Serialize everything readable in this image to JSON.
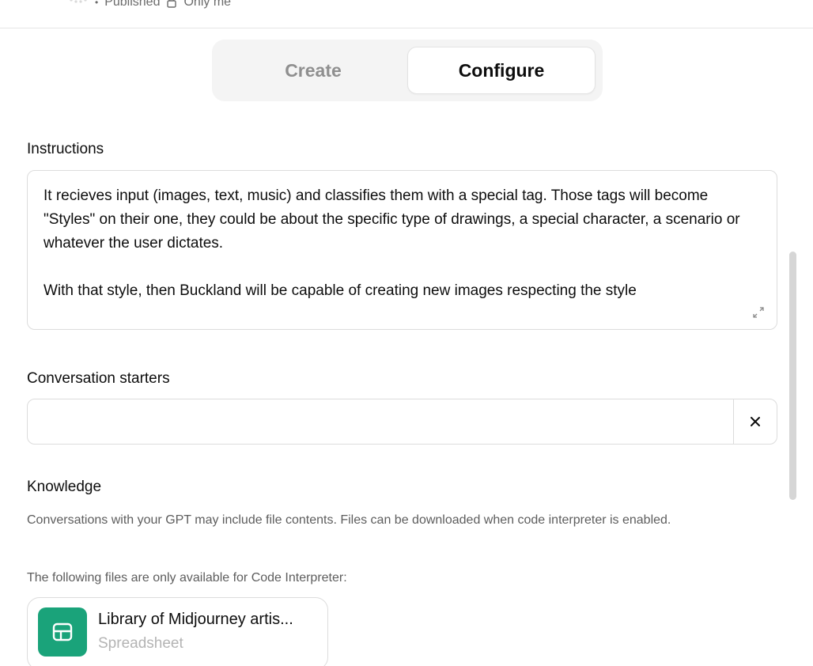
{
  "header": {
    "status_label": "Published",
    "visibility_label": "Only me"
  },
  "tabs": [
    {
      "label": "Create",
      "active": false
    },
    {
      "label": "Configure",
      "active": true
    }
  ],
  "instructions": {
    "label": "Instructions",
    "value": "It recieves input (images, text, music) and classifies them with a special tag. Those tags will become \"Styles\" on their one, they could be about the specific type of drawings, a special character, a scenario or whatever the user dictates.\n\nWith that style, then Buckland will be capable of creating new images respecting the style"
  },
  "conversation_starters": {
    "label": "Conversation starters",
    "value": "",
    "placeholder": ""
  },
  "knowledge": {
    "label": "Knowledge",
    "description": "Conversations with your GPT may include file contents. Files can be downloaded when code interpreter is enabled.",
    "code_interpreter_note": "The following files are only available for Code Interpreter:",
    "files": [
      {
        "name": "Library of Midjourney artis...",
        "type": "Spreadsheet",
        "icon": "spreadsheet-icon"
      }
    ]
  },
  "colors": {
    "accent_file_icon": "#1aa37a",
    "tab_background": "#f4f4f4"
  }
}
